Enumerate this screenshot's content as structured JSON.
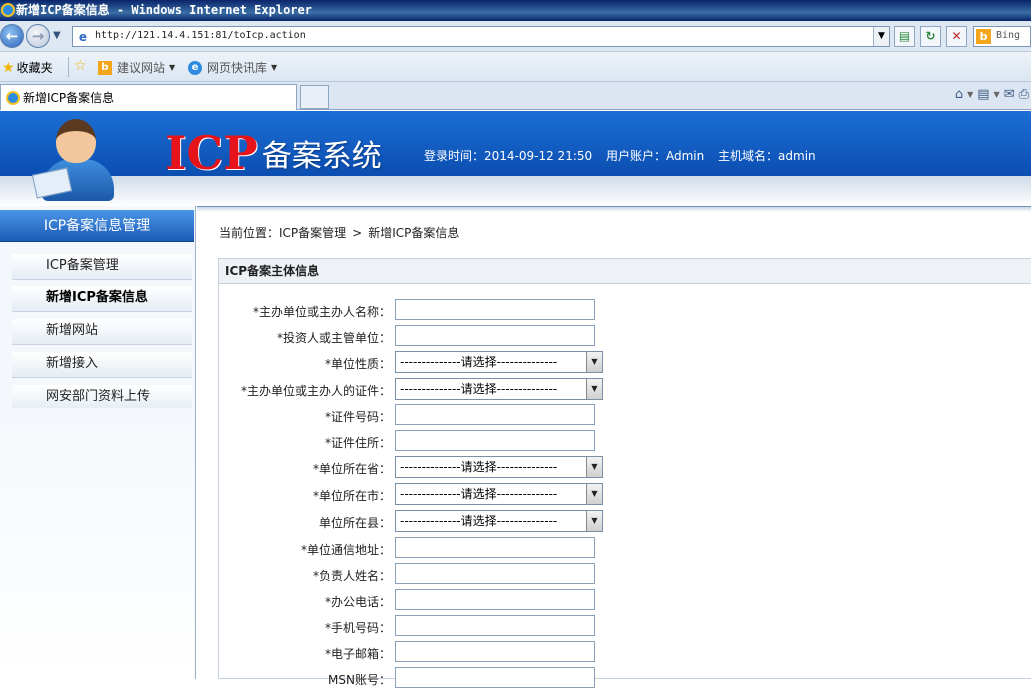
{
  "window": {
    "title": "新增ICP备案信息 - Windows Internet Explorer"
  },
  "addressbar": {
    "url": "http://121.14.4.151:81/toIcp.action",
    "search_text": "Bing"
  },
  "favorites": {
    "label": "收藏夹",
    "items": [
      {
        "label": "建议网站"
      },
      {
        "label": "网页快讯库"
      }
    ]
  },
  "tab": {
    "title": "新增ICP备案信息"
  },
  "banner": {
    "logo_main": "ICP",
    "logo_sub": "备案系统",
    "login_time": "登录时间：2014-09-12 21:50",
    "user_account": "用户账户：Admin",
    "host_domain": "主机域名：admin"
  },
  "sidebar": {
    "header": "ICP备案信息管理",
    "items": [
      {
        "label": "ICP备案管理",
        "active": false
      },
      {
        "label": "新增ICP备案信息",
        "active": true
      },
      {
        "label": "新增网站",
        "active": false
      },
      {
        "label": "新增接入",
        "active": false
      },
      {
        "label": "网安部门资料上传",
        "active": false
      }
    ]
  },
  "breadcrumb": {
    "prefix": "当前位置：ICP备案管理",
    "arrow": ">",
    "current": "新增ICP备案信息"
  },
  "form": {
    "title": "ICP备案主体信息",
    "select_placeholder": "--------------请选择--------------",
    "fields": [
      {
        "label": "*主办单位或主办人名称：",
        "type": "text",
        "value": ""
      },
      {
        "label": "*投资人或主管单位：",
        "type": "text",
        "value": ""
      },
      {
        "label": "*单位性质：",
        "type": "select",
        "value": "--------------请选择--------------"
      },
      {
        "label": "*主办单位或主办人的证件：",
        "type": "select",
        "value": "--------------请选择--------------"
      },
      {
        "label": "*证件号码：",
        "type": "text",
        "value": ""
      },
      {
        "label": "*证件住所：",
        "type": "text",
        "value": ""
      },
      {
        "label": "*单位所在省：",
        "type": "select",
        "value": "--------------请选择--------------"
      },
      {
        "label": "*单位所在市：",
        "type": "select",
        "value": "--------------请选择--------------"
      },
      {
        "label": "单位所在县：",
        "type": "select",
        "value": "--------------请选择--------------"
      },
      {
        "label": "*单位通信地址：",
        "type": "text",
        "value": ""
      },
      {
        "label": "*负责人姓名：",
        "type": "text",
        "value": ""
      },
      {
        "label": "*办公电话：",
        "type": "text",
        "value": ""
      },
      {
        "label": "*手机号码：",
        "type": "text",
        "value": ""
      },
      {
        "label": "*电子邮箱：",
        "type": "text",
        "value": ""
      },
      {
        "label": "MSN账号：",
        "type": "text",
        "value": ""
      }
    ]
  }
}
